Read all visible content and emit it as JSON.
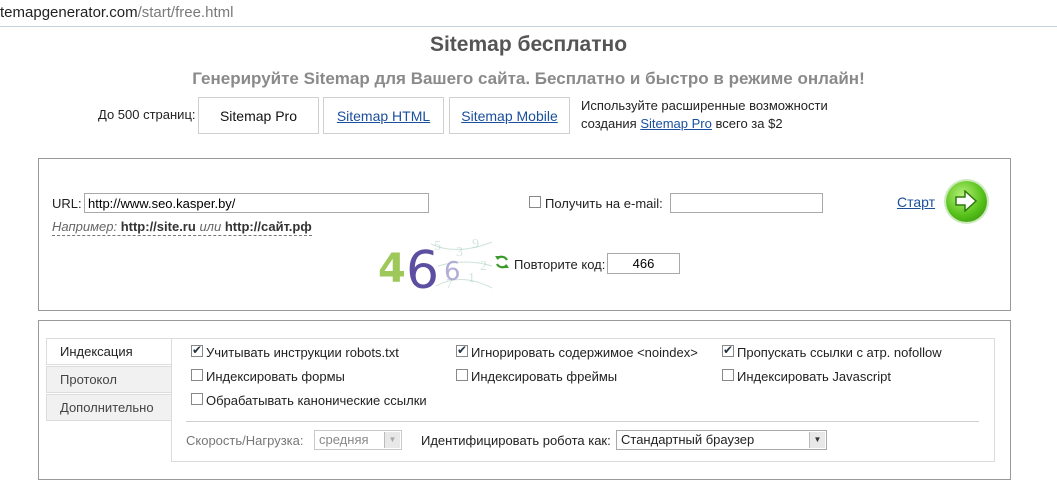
{
  "address_bar": {
    "url_host": "temapgenerator.com",
    "url_path": "/start/free.html"
  },
  "header": {
    "title": "Sitemap бесплатно",
    "subtitle": "Генерируйте Sitemap для Вашего сайта. Бесплатно и быстро в режиме онлайн!"
  },
  "plans": {
    "limit_label": "До 500 страниц:",
    "items": [
      {
        "label": "Sitemap Pro",
        "active": true
      },
      {
        "label": "Sitemap HTML",
        "active": false
      },
      {
        "label": "Sitemap Mobile",
        "active": false
      }
    ],
    "promo": {
      "text_before": "Используйте расширенные возможности создания",
      "link": "Sitemap Pro",
      "text_after": "всего за $2"
    }
  },
  "form": {
    "url_label": "URL:",
    "url_value": "http://www.seo.kasper.by/",
    "example": {
      "prefix": "Например:",
      "ex1": "http://site.ru",
      "or": "или",
      "ex2": "http://сайт.рф"
    },
    "email_checkbox_label": "Получить на e-mail:",
    "email_checked": false,
    "email_value": "",
    "start_label": "Старт",
    "captcha_text": "466",
    "captcha_label": "Повторите код:",
    "captcha_value": "466",
    "icons": {
      "start": "arrow-right-icon",
      "refresh": "refresh-icon"
    },
    "accent_color": "#57c21a"
  },
  "settings": {
    "tabs": [
      {
        "label": "Индексация",
        "active": true
      },
      {
        "label": "Протокол",
        "active": false
      },
      {
        "label": "Дополнительно",
        "active": false
      }
    ],
    "options": [
      {
        "label": "Учитывать инструкции robots.txt",
        "checked": true
      },
      {
        "label": "Игнорировать содержимое <noindex>",
        "checked": true
      },
      {
        "label": "Пропускать ссылки с атр. nofollow",
        "checked": true
      },
      {
        "label": "Индексировать формы",
        "checked": false
      },
      {
        "label": "Индексировать фреймы",
        "checked": false
      },
      {
        "label": "Индексировать Javascript",
        "checked": false
      },
      {
        "label": "Обрабатывать канонические ссылки",
        "checked": false
      }
    ],
    "speed_label": "Скорость/Нагрузка:",
    "speed_value": "средняя",
    "robot_label": "Идентифицировать робота как:",
    "robot_value": "Стандартный браузер"
  }
}
